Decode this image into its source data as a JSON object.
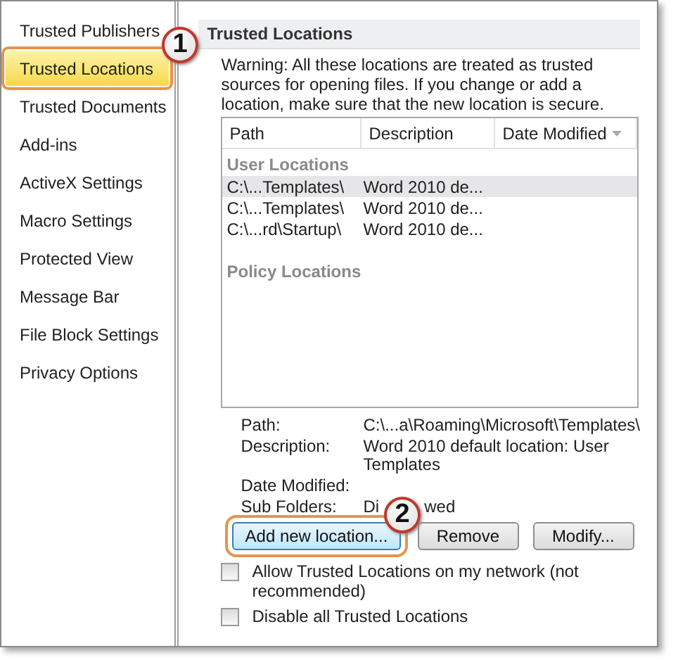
{
  "sidebar": {
    "items": [
      {
        "label": "Trusted Publishers",
        "selected": false
      },
      {
        "label": "Trusted Locations",
        "selected": true
      },
      {
        "label": "Trusted Documents",
        "selected": false
      },
      {
        "label": "Add-ins",
        "selected": false
      },
      {
        "label": "ActiveX Settings",
        "selected": false
      },
      {
        "label": "Macro Settings",
        "selected": false
      },
      {
        "label": "Protected View",
        "selected": false
      },
      {
        "label": "Message Bar",
        "selected": false
      },
      {
        "label": "File Block Settings",
        "selected": false
      },
      {
        "label": "Privacy Options",
        "selected": false
      }
    ]
  },
  "callouts": [
    "1",
    "2"
  ],
  "section": {
    "title": "Trusted Locations",
    "warning": "Warning: All these locations are treated as trusted sources for opening files.  If you change or add a location, make sure that the new location is secure."
  },
  "table": {
    "columns": [
      "Path",
      "Description",
      "Date Modified"
    ],
    "groups": [
      {
        "title": "User Locations",
        "rows": [
          {
            "path": "C:\\...Templates\\",
            "description": "Word 2010 de...",
            "selected": true
          },
          {
            "path": "C:\\...Templates\\",
            "description": "Word 2010 de...",
            "selected": false
          },
          {
            "path": "C:\\...rd\\Startup\\",
            "description": "Word 2010 de...",
            "selected": false
          }
        ]
      },
      {
        "title": "Policy Locations"
      }
    ]
  },
  "details": {
    "path_label": "Path:",
    "path": "C:\\...a\\Roaming\\Microsoft\\Templates\\",
    "description_label": "Description:",
    "description": "Word 2010 default location: User Templates",
    "date_label": "Date Modified:",
    "subfolders_label": "Sub Folders:",
    "subfolders_parts": [
      "Di",
      "wed"
    ]
  },
  "buttons": [
    {
      "label": "Add new location...",
      "focused": true
    },
    {
      "label": "Remove",
      "focused": false
    },
    {
      "label": "Modify...",
      "focused": false
    }
  ],
  "checkboxes": [
    {
      "label": "Allow Trusted Locations on my network (not recommended)",
      "checked": false
    },
    {
      "label": "Disable all Trusted Locations",
      "checked": false
    }
  ]
}
